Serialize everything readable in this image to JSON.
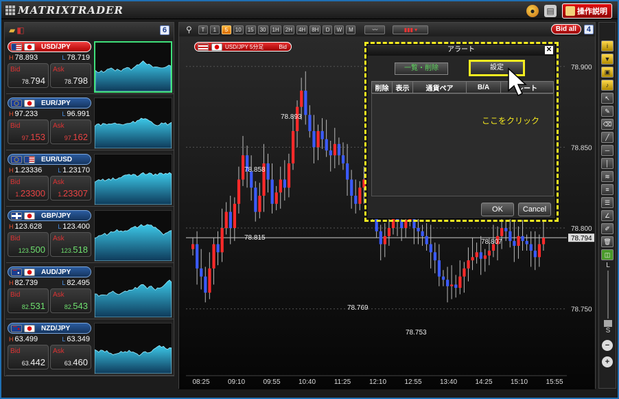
{
  "app": {
    "logo": "MATRIXTRADER",
    "manual_label": "操作説明"
  },
  "left_panel": {
    "count": "6",
    "pairs": [
      {
        "name": "USD/JPY",
        "flags": [
          "us",
          "jp"
        ],
        "high": "78.893",
        "low": "78.719",
        "bid_prefix": "78.",
        "bid_main": "794",
        "ask_prefix": "78.",
        "ask_main": "798",
        "active": true,
        "bid_color": "white",
        "ask_color": "white"
      },
      {
        "name": "EUR/JPY",
        "flags": [
          "eu",
          "jp"
        ],
        "high": "97.233",
        "low": "96.991",
        "bid_prefix": "97.",
        "bid_main": "153",
        "ask_prefix": "97.",
        "ask_main": "162",
        "active": false,
        "bid_color": "red",
        "ask_color": "red"
      },
      {
        "name": "EUR/USD",
        "flags": [
          "eu",
          "us"
        ],
        "high": "1.23336",
        "low": "1.23170",
        "bid_prefix": "1.",
        "bid_main": "23300",
        "ask_prefix": "1.",
        "ask_main": "23307",
        "active": false,
        "bid_color": "red",
        "ask_color": "red"
      },
      {
        "name": "GBP/JPY",
        "flags": [
          "gb",
          "jp"
        ],
        "high": "123.628",
        "low": "123.400",
        "bid_prefix": "123.",
        "bid_main": "500",
        "ask_prefix": "123.",
        "ask_main": "518",
        "active": false,
        "bid_color": "green",
        "ask_color": "green"
      },
      {
        "name": "AUD/JPY",
        "flags": [
          "au",
          "jp"
        ],
        "high": "82.739",
        "low": "82.495",
        "bid_prefix": "82.",
        "bid_main": "531",
        "ask_prefix": "82.",
        "ask_main": "543",
        "active": false,
        "bid_color": "green",
        "ask_color": "green"
      },
      {
        "name": "NZD/JPY",
        "flags": [
          "nz",
          "jp"
        ],
        "high": "63.499",
        "low": "63.349",
        "bid_prefix": "63.",
        "bid_main": "442",
        "ask_prefix": "63.",
        "ask_main": "460",
        "active": false,
        "bid_color": "white",
        "ask_color": "white"
      }
    ],
    "bid_label": "Bid",
    "ask_label": "Ask"
  },
  "chart": {
    "timeframes": [
      "T",
      "1",
      "5",
      "10",
      "15",
      "30",
      "1H",
      "2H",
      "4H",
      "8H",
      "D",
      "W",
      "M"
    ],
    "selected_timeframe": "5",
    "bid_all_label": "Bid all",
    "count": "4",
    "tab_label": "USD/JPY 5分足",
    "tab_side": "Bid",
    "y_ticks": [
      "78.900",
      "78.850",
      "78.800",
      "78.750"
    ],
    "current_price": "78.794",
    "x_ticks": [
      "08:25",
      "09:10",
      "09:55",
      "10:40",
      "11:25",
      "12:10",
      "12:55",
      "13:40",
      "14:25",
      "15:10",
      "15:55"
    ],
    "annotations": [
      "78.893",
      "78.858",
      "78.815",
      "78.769",
      "78.753",
      "78.807"
    ]
  },
  "alert_dialog": {
    "title": "アラート",
    "list_delete_label": "一覧・削除",
    "settings_label": "設定",
    "columns": [
      "削除",
      "表示",
      "通貨ペア",
      "B/A",
      "レート"
    ],
    "click_hint": "ここをクリック",
    "ok_label": "OK",
    "cancel_label": "Cancel"
  }
}
